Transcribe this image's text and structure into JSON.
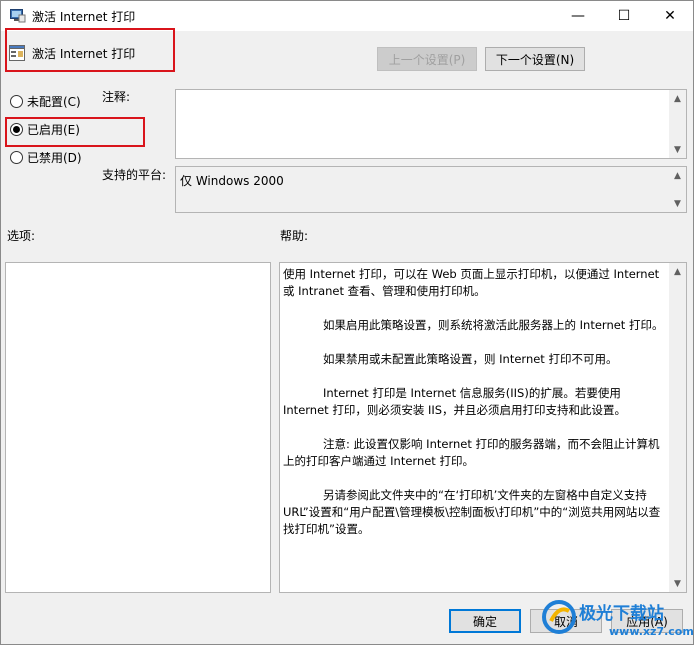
{
  "window": {
    "title": "激活 Internet 打印",
    "minimize": "—",
    "maximize": "☐",
    "close": "✕"
  },
  "header": {
    "title": "激活 Internet 打印"
  },
  "nav": {
    "prev_label": "上一个设置(P)",
    "next_label": "下一个设置(N)"
  },
  "state": {
    "not_configured": "未配置(C)",
    "enabled": "已启用(E)",
    "disabled": "已禁用(D)",
    "selected": "enabled"
  },
  "comment": {
    "label": "注释:",
    "value": ""
  },
  "platform": {
    "label": "支持的平台:",
    "value": "仅 Windows 2000"
  },
  "options": {
    "label": "选项:"
  },
  "help": {
    "label": "帮助:",
    "paragraphs": [
      "使用 Internet 打印，可以在 Web 页面上显示打印机，以便通过 Internet 或 Intranet 查看、管理和使用打印机。",
      "如果启用此策略设置，则系统将激活此服务器上的 Internet 打印。",
      "如果禁用或未配置此策略设置，则 Internet 打印不可用。",
      "Internet 打印是 Internet 信息服务(IIS)的扩展。若要使用 Internet 打印，则必须安装 IIS，并且必须启用打印支持和此设置。",
      "注意: 此设置仅影响 Internet 打印的服务器端，而不会阻止计算机上的打印客户端通过 Internet 打印。",
      "另请参阅此文件夹中的“在‘打印机’文件夹的左窗格中自定义支持 URL”设置和“用户配置\\管理模板\\控制面板\\打印机”中的“浏览共用网站以查找打印机”设置。"
    ]
  },
  "footer": {
    "ok_label": "确定",
    "cancel_label": "取消",
    "apply_label": "应用(A)"
  },
  "watermark": {
    "text": "极光下载站",
    "url": "www.xz7.com"
  },
  "colors": {
    "highlight_red": "#d9141b",
    "accent_blue": "#0078d7"
  }
}
